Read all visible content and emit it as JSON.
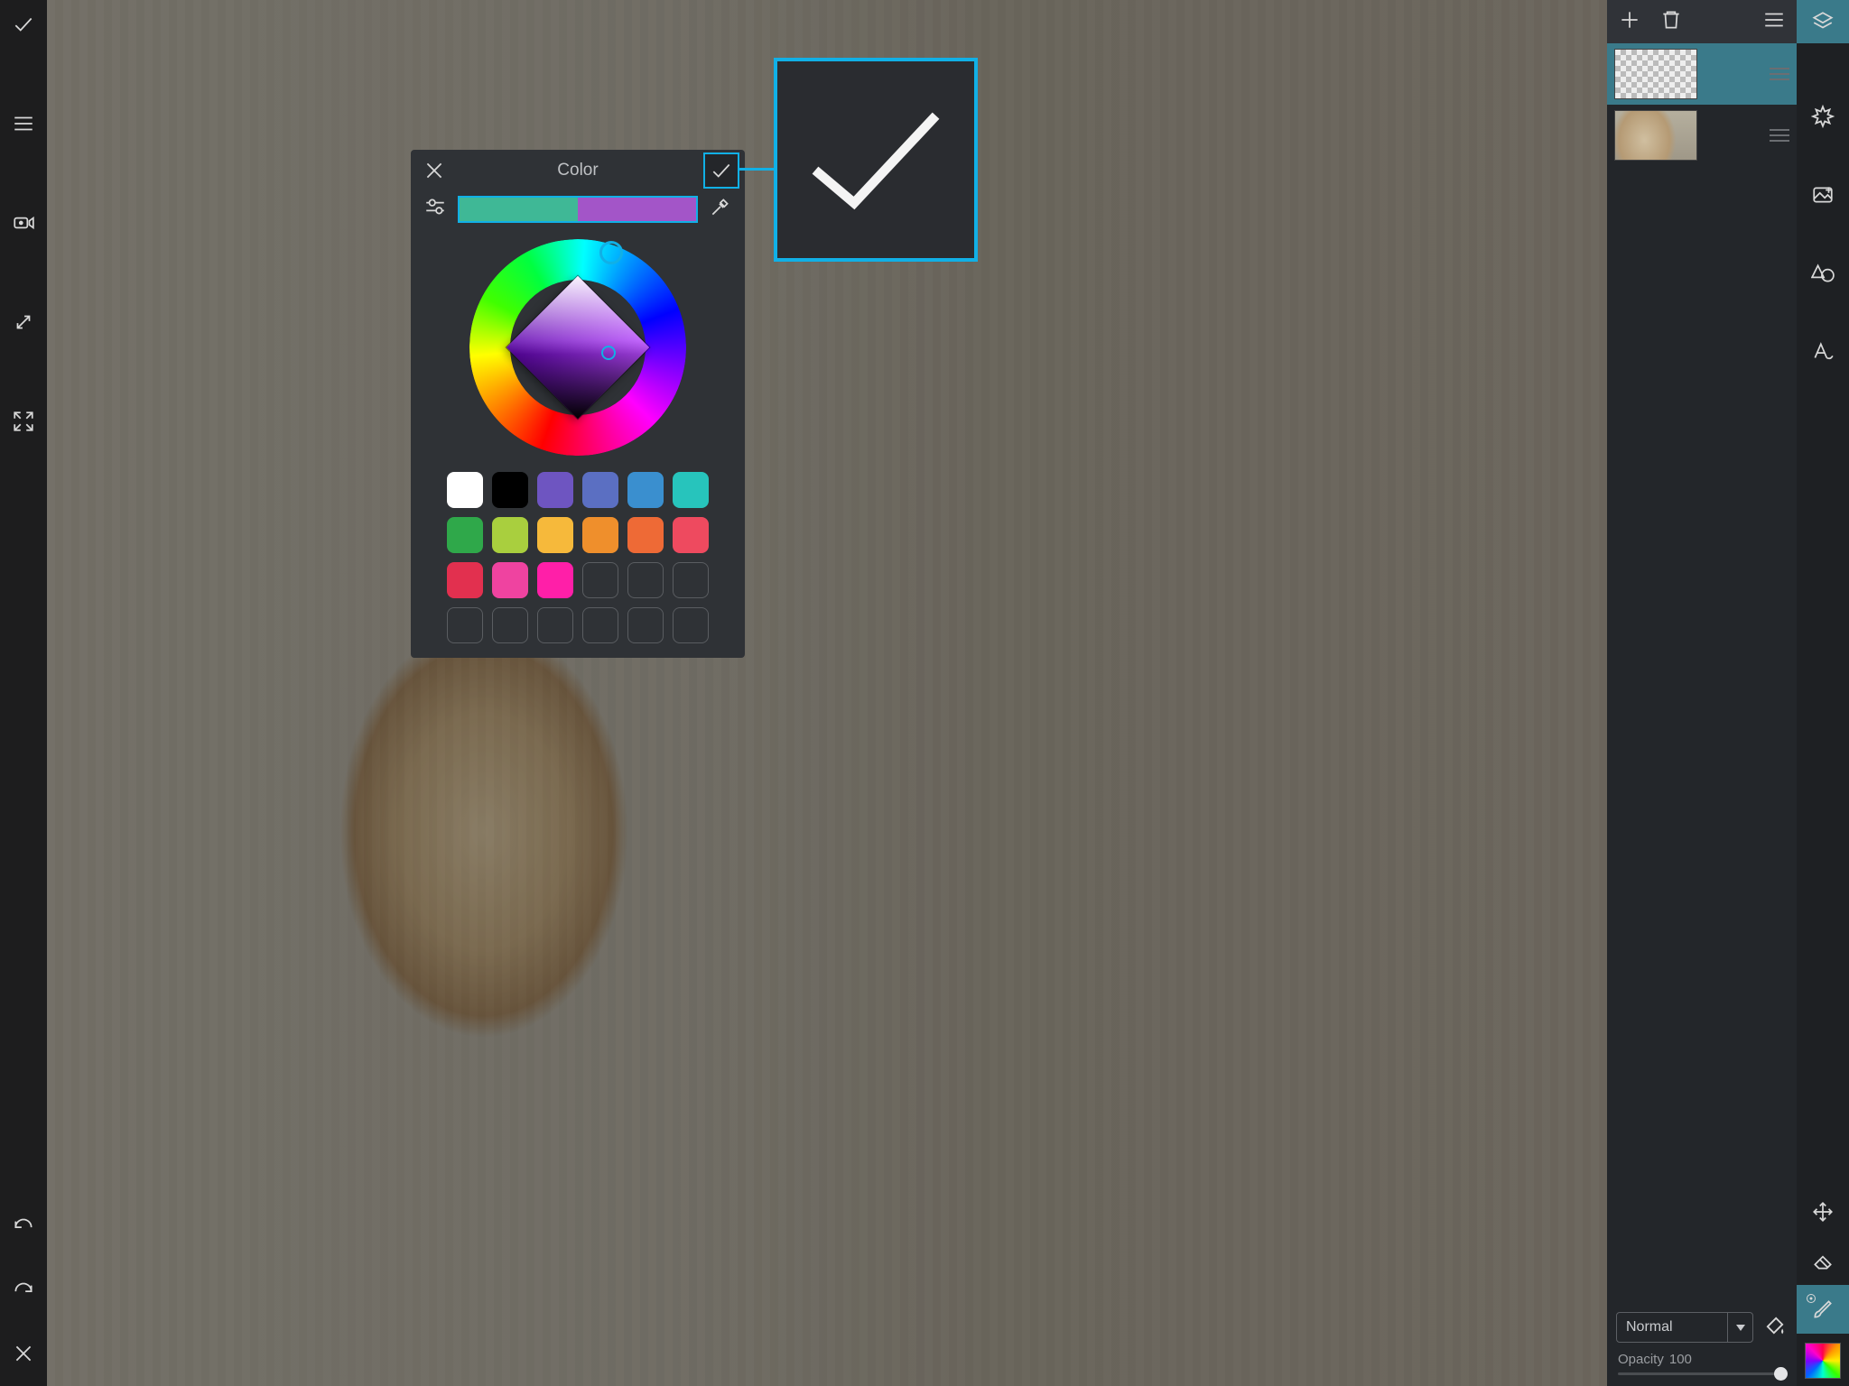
{
  "popover": {
    "title": "Color",
    "current_color": "#3fb896",
    "new_color": "#a355c8",
    "swatches": [
      "#ffffff",
      "#000000",
      "#6e55c1",
      "#5b6fc2",
      "#3a8fcf",
      "#27c4bc",
      "#2fa84a",
      "#a9cf3e",
      "#f6b93b",
      "#ef8f2c",
      "#ee6a36",
      "#ee4a5f",
      "#e2304f",
      "#ef43a0",
      "#ff1fa8",
      "",
      "",
      "",
      "",
      "",
      "",
      "",
      "",
      ""
    ]
  },
  "blend": {
    "mode": "Normal",
    "opacity_label": "Opacity",
    "opacity_value": "100"
  }
}
